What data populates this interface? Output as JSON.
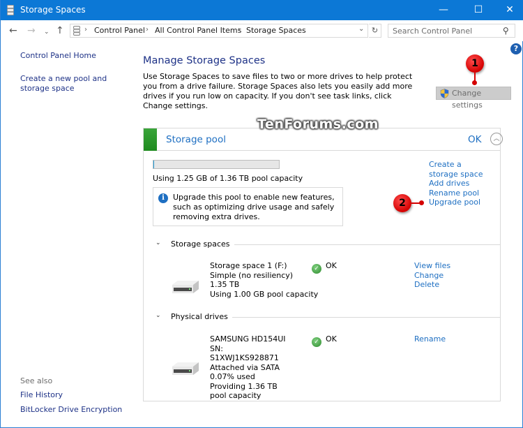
{
  "window": {
    "title": "Storage Spaces",
    "controls": {
      "minimize": "—",
      "maximize": "☐",
      "close": "✕"
    }
  },
  "navbar": {
    "back_icon": "←",
    "forward_icon": "→",
    "recent_icon": "⌄",
    "up_icon": "↑",
    "breadcrumb": [
      "Control Panel",
      "All Control Panel Items",
      "Storage Spaces"
    ],
    "separator": "›",
    "dropdown_icon": "⌄",
    "refresh_icon": "↻",
    "search": {
      "placeholder": "Search Control Panel",
      "value": "",
      "icon": "⚲"
    }
  },
  "sidebar": {
    "links": [
      "Control Panel Home",
      "Create a new pool and storage space"
    ],
    "see_also_heading": "See also",
    "see_also": [
      "File History",
      "BitLocker Drive Encryption"
    ]
  },
  "main": {
    "help_icon": "?",
    "title": "Manage Storage Spaces",
    "description": "Use Storage Spaces to save files to two or more drives to help protect you from a drive failure. Storage Spaces also lets you easily add more drives if you run low on capacity. If you don't see task links, click Change settings.",
    "change_settings_label": "Change settings"
  },
  "callouts": [
    "1",
    "2"
  ],
  "watermark": "TenForums.com",
  "pool": {
    "title": "Storage pool",
    "status": "OK",
    "collapse_icon": "︿",
    "capacity_used_fraction": 0.0009,
    "capacity_text": "Using 1.25 GB of 1.36 TB pool capacity",
    "upgrade_info_icon": "i",
    "upgrade_message": "Upgrade this pool to enable new features, such as optimizing drive usage and safely removing extra drives.",
    "tasks": [
      "Create a storage space",
      "Add drives",
      "Rename pool",
      "Upgrade pool"
    ]
  },
  "storage_spaces": {
    "heading": "Storage spaces",
    "chevron": "⌄",
    "items": [
      {
        "lines": [
          "Storage space 1 (F:)",
          "Simple (no resiliency)",
          "1.35 TB",
          "Using 1.00 GB pool capacity"
        ],
        "status": "OK",
        "links": [
          "View files",
          "Change",
          "Delete"
        ]
      }
    ]
  },
  "physical_drives": {
    "heading": "Physical drives",
    "chevron": "⌄",
    "items": [
      {
        "lines": [
          "SAMSUNG HD154UI",
          "SN: S1XWJ1KS928871",
          "Attached via SATA",
          "0.07% used",
          "Providing 1.36 TB pool capacity"
        ],
        "status": "OK",
        "links": [
          "Rename"
        ]
      }
    ]
  },
  "colors": {
    "titlebar": "#0c78d6",
    "link": "#1e6fc2",
    "heading": "#1e3287",
    "pool_status_green": "#2e9a2e",
    "callout_red": "#d40000"
  }
}
